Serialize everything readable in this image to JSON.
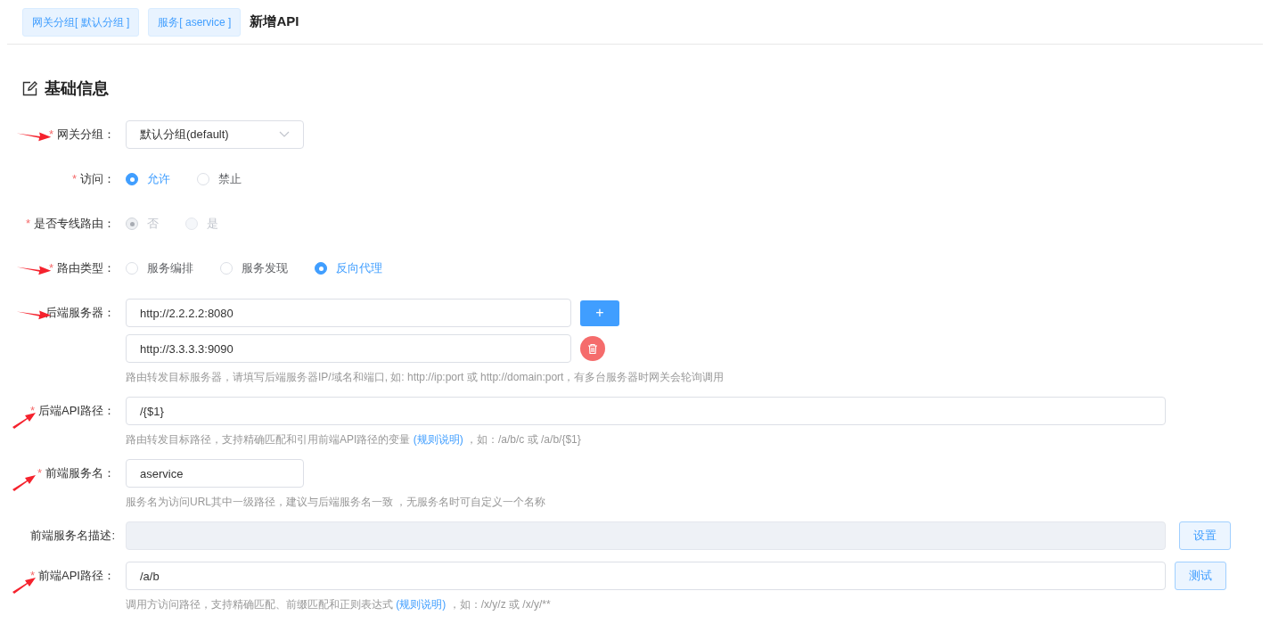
{
  "breadcrumbs": [
    {
      "label": "网关分组[ 默认分组 ]"
    },
    {
      "label": "服务[ aservice ]"
    }
  ],
  "page_title": "新增API",
  "section_title": "基础信息",
  "fields": [
    {
      "kind": "select",
      "label": "网关分组：",
      "required_mark": "*",
      "annotation": {
        "kind": "right-arrow"
      },
      "value": "默认分组(default)"
    },
    {
      "kind": "radio",
      "label": "访问：",
      "required_mark": "*",
      "disabled": false,
      "options": [
        {
          "label": "允许",
          "selected": true
        },
        {
          "label": "禁止",
          "selected": false
        }
      ]
    },
    {
      "kind": "radio",
      "label": "是否专线路由：",
      "required_mark": "*",
      "disabled": true,
      "options": [
        {
          "label": "否",
          "selected": true
        },
        {
          "label": "是",
          "selected": false
        }
      ]
    },
    {
      "kind": "radio",
      "label": "路由类型：",
      "required_mark": "*",
      "annotation": {
        "kind": "right-arrow"
      },
      "disabled": false,
      "options": [
        {
          "label": "服务编排",
          "selected": false
        },
        {
          "label": "服务发现",
          "selected": false
        },
        {
          "label": "反向代理",
          "selected": true
        }
      ]
    },
    {
      "kind": "servers",
      "label": "后端服务器：",
      "annotation": {
        "kind": "right-arrow"
      },
      "servers": [
        {
          "value": "http://2.2.2.2:8080",
          "button": {
            "kind": "add",
            "label": "+"
          }
        },
        {
          "value": "http://3.3.3.3:9090",
          "button": {
            "kind": "delete"
          }
        }
      ],
      "hint": {
        "text": "路由转发目标服务器，请填写后端服务器IP/域名和端口, 如: http://ip:port 或 http://domain:port，有多台服务器时网关会轮询调用"
      }
    },
    {
      "kind": "long-text",
      "label": "后端API路径：",
      "required_mark": "*",
      "annotation": {
        "kind": "diagonal-arrow"
      },
      "value": "/{$1}",
      "hint": {
        "text": "路由转发目标路径，支持精确匹配和引用前端API路径的变量 ",
        "link": "(规则说明)",
        "after": " ，如：/a/b/c 或 /a/b/{$1}"
      }
    },
    {
      "kind": "short-text",
      "label": "前端服务名：",
      "required_mark": "*",
      "annotation": {
        "kind": "diagonal-arrow"
      },
      "value": "aservice",
      "hint": {
        "text": "服务名为访问URL其中一级路径，建议与后端服务名一致 ，无服务名时可自定义一个名称"
      }
    },
    {
      "kind": "long-text",
      "label": "前端服务名描述:",
      "disabled": true,
      "button": "设置"
    },
    {
      "kind": "long-text",
      "label": "前端API路径：",
      "required_mark": "*",
      "annotation": {
        "kind": "diagonal-arrow"
      },
      "value": "/a/b",
      "button": "测试",
      "hint": {
        "text": "调用方访问路径，支持精确匹配、前缀匹配和正则表达式 ",
        "link": "(规则说明)",
        "after": " ，如：/x/y/z 或 /x/y/**"
      }
    }
  ]
}
